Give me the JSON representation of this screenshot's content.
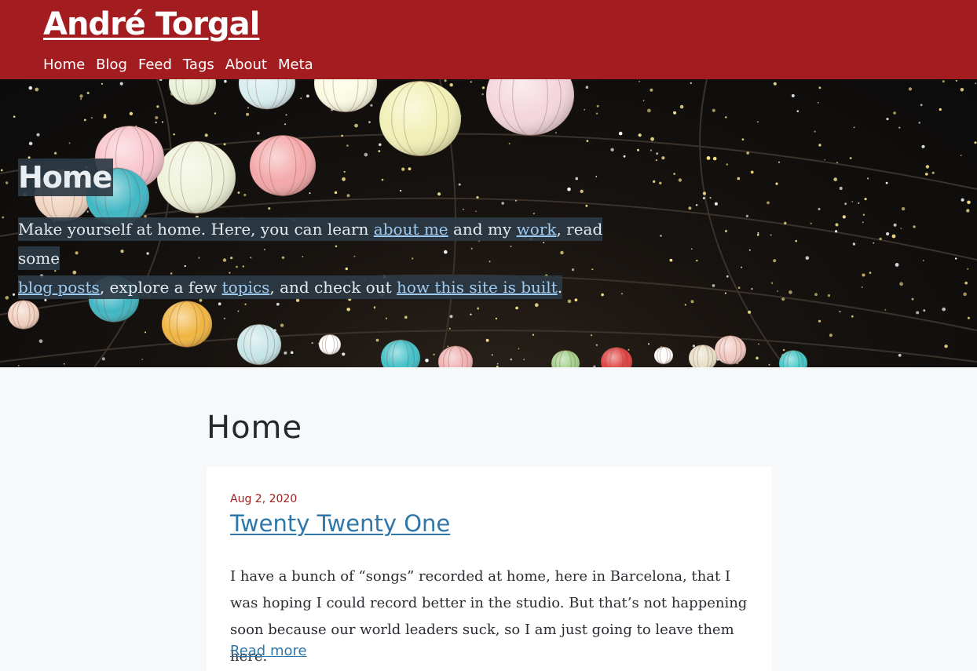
{
  "site": {
    "title": "André Torgal"
  },
  "nav": {
    "items": [
      {
        "label": "Home"
      },
      {
        "label": "Blog"
      },
      {
        "label": "Feed"
      },
      {
        "label": "Tags"
      },
      {
        "label": "About"
      },
      {
        "label": "Meta"
      }
    ]
  },
  "hero": {
    "title": "Home",
    "intro": {
      "t1": "Make yourself at home. Here, you can learn ",
      "link_about": "about me",
      "t2": " and my ",
      "link_work": "work",
      "t3": ", read some ",
      "link_posts": "blog posts",
      "t4": ", explore a few ",
      "link_topics": "topics",
      "t5": ", and check out ",
      "link_built": "how this site is built",
      "t6": "."
    }
  },
  "main": {
    "heading": "Home",
    "posts": [
      {
        "date": "Aug 2, 2020",
        "title": "Twenty Twenty One",
        "excerpt": "I have a bunch of “songs” recorded at home, here in Barcelona, that I was hoping I could record better in the studio. But that’s not happening soon because our world leaders suck, so I am just going to leave them here.",
        "read_more": "Read more"
      }
    ]
  },
  "colors": {
    "header_bg": "#a31c1f",
    "page_bg": "#f6f8fa",
    "link": "#2f77a9",
    "hero_link": "#9fcaf0",
    "date": "#a31c1f",
    "hero_text_bg": "#2c3944"
  }
}
